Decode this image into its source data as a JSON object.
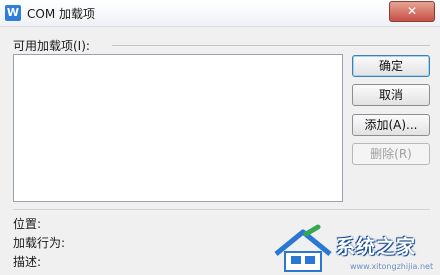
{
  "window": {
    "title": "COM 加载项",
    "icon": "wps-icon",
    "icon_letter": "W",
    "close_label": "✕"
  },
  "list": {
    "label": "可用加载项(I):"
  },
  "buttons": {
    "ok": "确定",
    "cancel": "取消",
    "add": "添加(A)...",
    "remove": "删除(R)"
  },
  "details": {
    "location": "位置:",
    "load_behavior": "加载行为:",
    "description": "描述:"
  },
  "watermark": {
    "brand": "系统之家",
    "sub": "www.xitongzhijia.net"
  }
}
